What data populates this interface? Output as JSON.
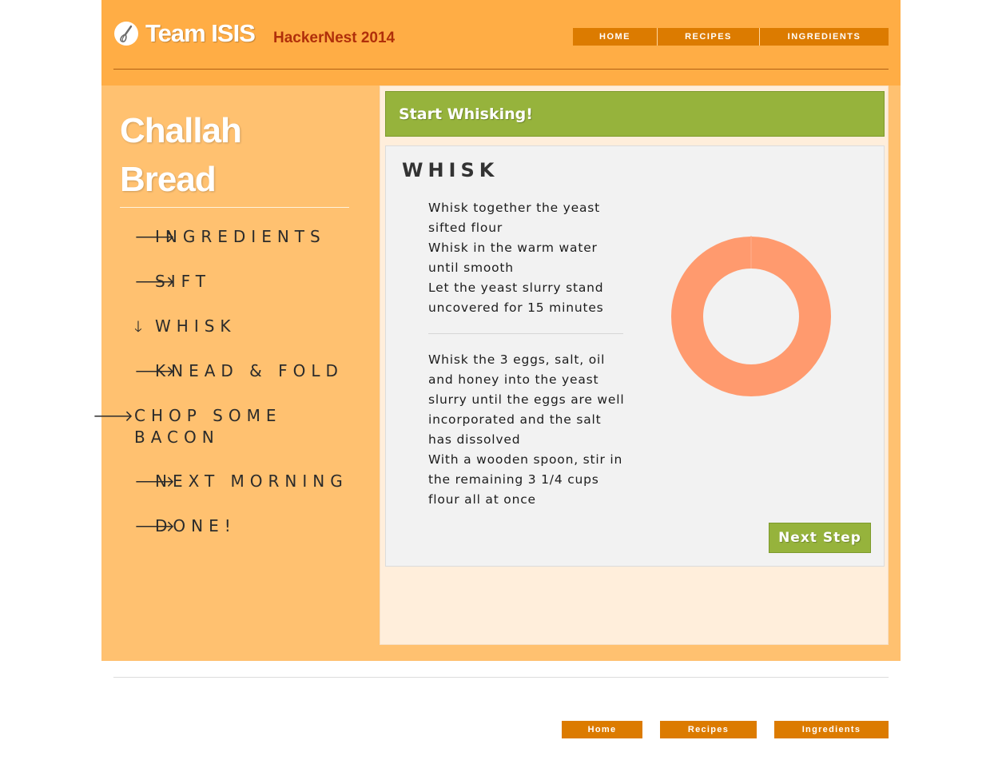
{
  "header": {
    "brand": "Team ISIS",
    "event": "HackerNest 2014",
    "logo_icon": "whisk-icon",
    "nav": [
      "HOME",
      "RECIPES",
      "INGREDIENTS"
    ]
  },
  "recipe": {
    "title_line1": "Challah",
    "title_line2": "Bread"
  },
  "steps": [
    {
      "label": "INGREDIENTS",
      "icon": "arrow-right-icon"
    },
    {
      "label": "SIFT",
      "icon": "arrow-right-icon"
    },
    {
      "label": "WHISK",
      "icon": "arrow-down-icon",
      "current": true
    },
    {
      "label": "KNEAD & FOLD",
      "icon": "arrow-right-icon"
    },
    {
      "label": "CHOP SOME BACON",
      "icon": "arrow-right-icon"
    },
    {
      "label": "NEXT MORNING",
      "icon": "arrow-right-icon"
    },
    {
      "label": "DONE!",
      "icon": "arrow-right-icon"
    }
  ],
  "content": {
    "banner": "Start Whisking!",
    "heading": "WHISK",
    "block1": [
      "Whisk together the yeast",
      "sifted flour",
      "Whisk in the warm water",
      "until smooth",
      "Let the yeast slurry stand",
      "uncovered for 15 minutes"
    ],
    "block2": [
      "Whisk the 3 eggs, salt, oil",
      "and honey into the yeast",
      "slurry until the eggs are well",
      "incorporated and the salt",
      "has dissolved",
      "With a wooden spoon, stir in",
      "the remaining 3 1/4 cups",
      "flour all at once"
    ],
    "timer": {
      "progress": 0.0,
      "ring_color": "#ff9a6e"
    },
    "next_label": "Next Step"
  },
  "footer": {
    "nav": [
      "Home",
      "Recipes",
      "Ingredients"
    ]
  },
  "colors": {
    "header_bg": "#ffad45",
    "panel_bg": "#ffc170",
    "nav_button": "#dc7b00",
    "accent_green": "#96b33c",
    "event_red": "#b02f0a"
  }
}
